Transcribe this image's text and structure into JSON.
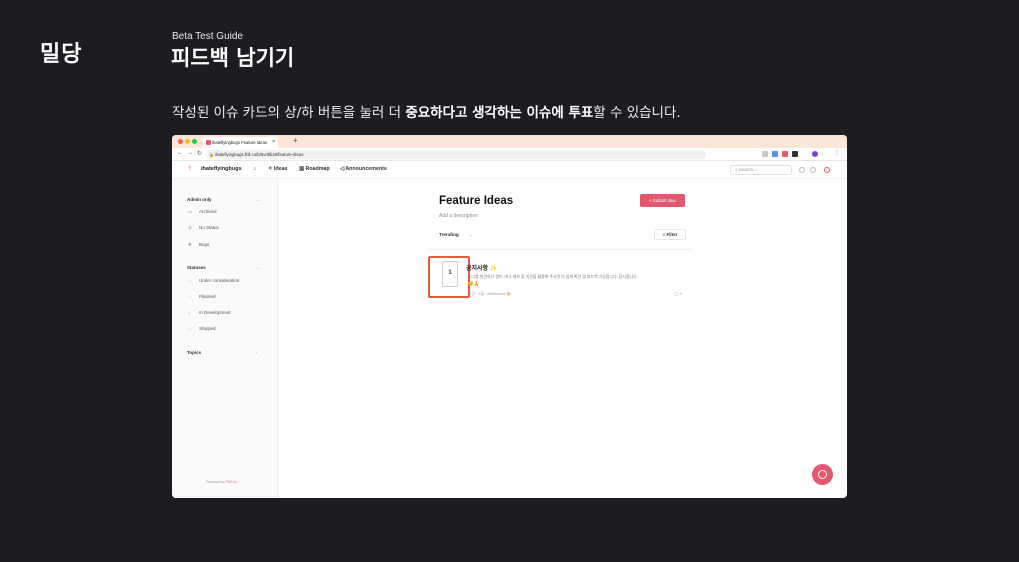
{
  "slide": {
    "logo": "밀당",
    "subtitle": "Beta Test Guide",
    "title": "피드백 남기기",
    "description_pre": "작성된 이슈 카드의 상/하 버튼을 눌러 더 ",
    "description_bold": "중요하다고 생각하는 이슈에 투표",
    "description_post": "할 수 있습니다."
  },
  "browser": {
    "tab_title": "ihateflyingbugs Feature Ideas",
    "tab_close": "×",
    "new_tab": "+",
    "url": "ihateflyingbugs.frill.co/b/6vr0lk40/feature-ideas",
    "colors": {
      "tabstrip": "#fde6d8",
      "dot_red": "#f25f57",
      "dot_yellow": "#f8bc2e",
      "dot_green": "#28c840"
    }
  },
  "app": {
    "name": "ihateflyingbugs",
    "nav": [
      "Ideas",
      "Roadmap",
      "Announcements"
    ],
    "search_placeholder": "Search...",
    "accent": "#e5566f"
  },
  "sidebar": {
    "groups": [
      {
        "label": "Admin only",
        "items": [
          {
            "label": "Archived",
            "icon": "archive-icon"
          },
          {
            "label": "No Status",
            "icon": "no-status-icon"
          },
          {
            "label": "Bugs",
            "icon": "bug-icon"
          }
        ]
      },
      {
        "label": "Statuses",
        "items": [
          {
            "label": "Under consideration",
            "icon": "status-dot-icon"
          },
          {
            "label": "Planned",
            "icon": "status-dot-icon"
          },
          {
            "label": "In Development",
            "icon": "status-dot-icon"
          },
          {
            "label": "Shipped",
            "icon": "status-dot-icon"
          }
        ]
      },
      {
        "label": "Topics",
        "items": []
      }
    ],
    "powered_label": "Powered by",
    "powered_brand": "Frill.co"
  },
  "main": {
    "title": "Feature Ideas",
    "description": "Add a description",
    "submit_label": "+ Submit Idea",
    "sort_label": "Trending",
    "filter_label": "Filter"
  },
  "post": {
    "vote_up": "^",
    "vote_count": "1",
    "title": "공지사항 ✨",
    "body": "버그를 발견하신 경우, 버그 제보 및 의견을 활용해 주시면 더 쉽게 확인 및 피드백 가능합니다. 감사합니다",
    "emoji": "😊🙏",
    "meta": "밀당 · 1월 · #Welcome 👋",
    "comments": "0"
  },
  "highlight_color": "#e85a3c"
}
